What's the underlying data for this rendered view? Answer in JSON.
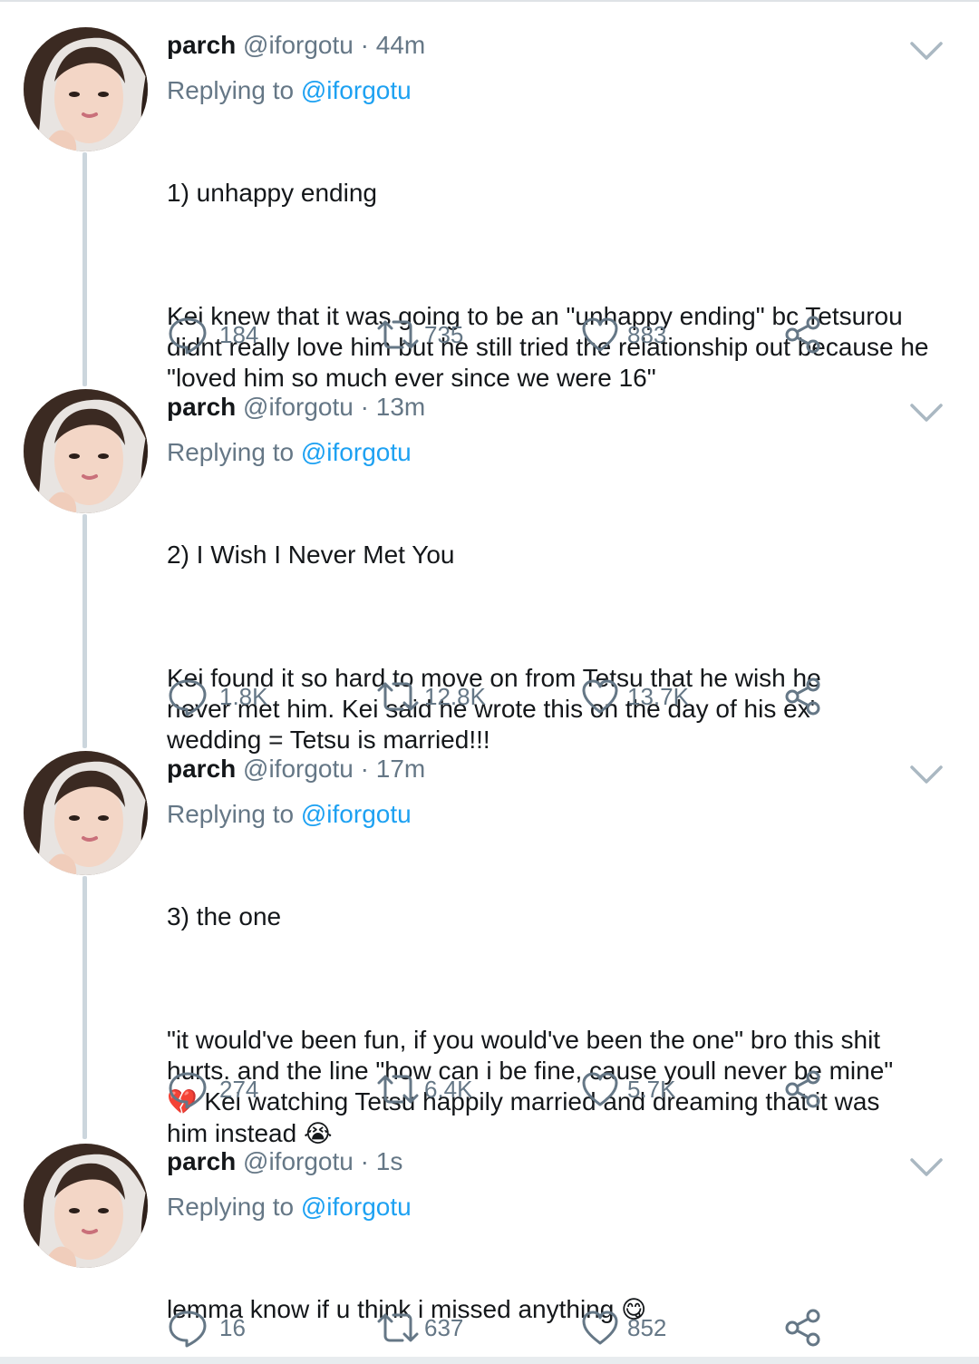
{
  "tweets": [
    {
      "name": "parch",
      "handle": "@iforgotu",
      "dot": "·",
      "time": "44m",
      "replying_prefix": "Replying to ",
      "replying_to": "@iforgotu",
      "paragraphs": [
        "1) unhappy ending",
        "Kei knew that it was going to be an \"unhappy ending\" bc Tetsurou didnt really love him but he still tried the relationship out because he \"loved him so much ever since we were 16\""
      ],
      "replies": "184",
      "retweets": "735",
      "likes": "883"
    },
    {
      "name": "parch",
      "handle": "@iforgotu",
      "dot": "·",
      "time": "13m",
      "replying_prefix": "Replying to ",
      "replying_to": "@iforgotu",
      "paragraphs": [
        "2) I Wish I Never Met You",
        "Kei found it so hard to move on from Tetsu that he wish he never met him. Kei said he wrote this on the day of his ex' wedding = Tetsu is married!!!"
      ],
      "replies": "1.8K",
      "retweets": "12.8K",
      "likes": "13.7K"
    },
    {
      "name": "parch",
      "handle": "@iforgotu",
      "dot": "·",
      "time": "17m",
      "replying_prefix": "Replying to ",
      "replying_to": "@iforgotu",
      "paragraphs": [
        "3) the one",
        "\"it would've been fun, if you would've been the one\" bro this shit hurts. and the line \"how can i be fine, cause youll never be mine\""
      ],
      "paragraph2_emoji1": "💔",
      "paragraph2_tail": " Kei watching Tetsu happily married and dreaming that it was him instead ",
      "paragraph2_emoji2": "😭",
      "replies": "274",
      "retweets": "6.4K",
      "likes": "5.7K"
    },
    {
      "name": "parch",
      "handle": "@iforgotu",
      "dot": "·",
      "time": "1s",
      "replying_prefix": "Replying to ",
      "replying_to": "@iforgotu",
      "paragraphs": [
        "lemma know if u think i missed anything "
      ],
      "paragraph1_emoji": "😋",
      "replies": "16",
      "retweets": "637",
      "likes": "852"
    }
  ],
  "icons": {
    "reply": "speech-bubble-icon",
    "retweet": "retweet-arrows-icon",
    "like": "heart-outline-icon",
    "share": "share-nodes-icon",
    "menu": "chevron-down-icon"
  },
  "colors": {
    "link": "#1da1f2",
    "muted": "#657786",
    "text": "#14171a",
    "thread_line": "#ccd6dd"
  }
}
